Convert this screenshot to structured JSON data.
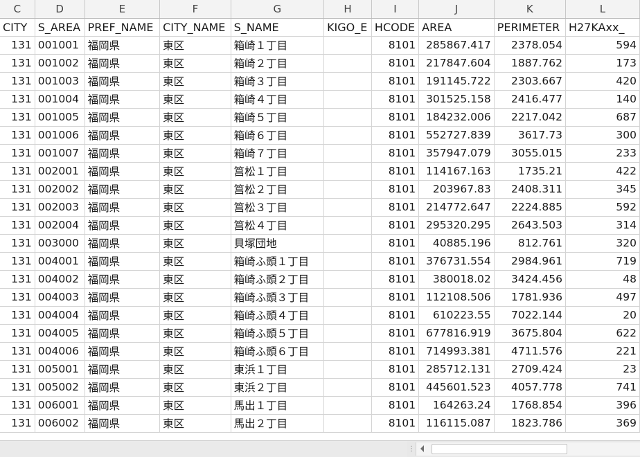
{
  "columns": [
    "C",
    "D",
    "E",
    "F",
    "G",
    "H",
    "I",
    "J",
    "K",
    "L"
  ],
  "field_headers": [
    "CITY",
    "S_AREA",
    "PREF_NAME",
    "CITY_NAME",
    "S_NAME",
    "KIGO_E",
    "HCODE",
    "AREA",
    "PERIMETER",
    "H27KAxx_"
  ],
  "rows": [
    [
      "131",
      "001001",
      "福岡県",
      "東区",
      "箱崎１丁目",
      "",
      "8101",
      "285867.417",
      "2378.054",
      "594"
    ],
    [
      "131",
      "001002",
      "福岡県",
      "東区",
      "箱崎２丁目",
      "",
      "8101",
      "217847.604",
      "1887.762",
      "173"
    ],
    [
      "131",
      "001003",
      "福岡県",
      "東区",
      "箱崎３丁目",
      "",
      "8101",
      "191145.722",
      "2303.667",
      "420"
    ],
    [
      "131",
      "001004",
      "福岡県",
      "東区",
      "箱崎４丁目",
      "",
      "8101",
      "301525.158",
      "2416.477",
      "140"
    ],
    [
      "131",
      "001005",
      "福岡県",
      "東区",
      "箱崎５丁目",
      "",
      "8101",
      "184232.006",
      "2217.042",
      "687"
    ],
    [
      "131",
      "001006",
      "福岡県",
      "東区",
      "箱崎６丁目",
      "",
      "8101",
      "552727.839",
      "3617.73",
      "300"
    ],
    [
      "131",
      "001007",
      "福岡県",
      "東区",
      "箱崎７丁目",
      "",
      "8101",
      "357947.079",
      "3055.015",
      "233"
    ],
    [
      "131",
      "002001",
      "福岡県",
      "東区",
      "筥松１丁目",
      "",
      "8101",
      "114167.163",
      "1735.21",
      "422"
    ],
    [
      "131",
      "002002",
      "福岡県",
      "東区",
      "筥松２丁目",
      "",
      "8101",
      "203967.83",
      "2408.311",
      "345"
    ],
    [
      "131",
      "002003",
      "福岡県",
      "東区",
      "筥松３丁目",
      "",
      "8101",
      "214772.647",
      "2224.885",
      "592"
    ],
    [
      "131",
      "002004",
      "福岡県",
      "東区",
      "筥松４丁目",
      "",
      "8101",
      "295320.295",
      "2643.503",
      "314"
    ],
    [
      "131",
      "003000",
      "福岡県",
      "東区",
      "貝塚団地",
      "",
      "8101",
      "40885.196",
      "812.761",
      "320"
    ],
    [
      "131",
      "004001",
      "福岡県",
      "東区",
      "箱崎ふ頭１丁目",
      "",
      "8101",
      "376731.554",
      "2984.961",
      "719"
    ],
    [
      "131",
      "004002",
      "福岡県",
      "東区",
      "箱崎ふ頭２丁目",
      "",
      "8101",
      "380018.02",
      "3424.456",
      "48"
    ],
    [
      "131",
      "004003",
      "福岡県",
      "東区",
      "箱崎ふ頭３丁目",
      "",
      "8101",
      "112108.506",
      "1781.936",
      "497"
    ],
    [
      "131",
      "004004",
      "福岡県",
      "東区",
      "箱崎ふ頭４丁目",
      "",
      "8101",
      "610223.55",
      "7022.144",
      "20"
    ],
    [
      "131",
      "004005",
      "福岡県",
      "東区",
      "箱崎ふ頭５丁目",
      "",
      "8101",
      "677816.919",
      "3675.804",
      "622"
    ],
    [
      "131",
      "004006",
      "福岡県",
      "東区",
      "箱崎ふ頭６丁目",
      "",
      "8101",
      "714993.381",
      "4711.576",
      "221"
    ],
    [
      "131",
      "005001",
      "福岡県",
      "東区",
      "東浜１丁目",
      "",
      "8101",
      "285712.131",
      "2709.424",
      "23"
    ],
    [
      "131",
      "005002",
      "福岡県",
      "東区",
      "東浜２丁目",
      "",
      "8101",
      "445601.523",
      "4057.778",
      "741"
    ],
    [
      "131",
      "006001",
      "福岡県",
      "東区",
      "馬出１丁目",
      "",
      "8101",
      "164263.24",
      "1768.854",
      "396"
    ],
    [
      "131",
      "006002",
      "福岡県",
      "東区",
      "馬出２丁目",
      "",
      "8101",
      "116115.087",
      "1823.786",
      "369"
    ]
  ],
  "icons": {
    "split_handle": "split-handle-icon",
    "scroll_left": "scroll-left-arrow-icon"
  },
  "colors": {
    "header_bg": "#f3f3f3",
    "gridline": "#d4d4d4",
    "statusbar_bg": "#e8e8e8"
  }
}
